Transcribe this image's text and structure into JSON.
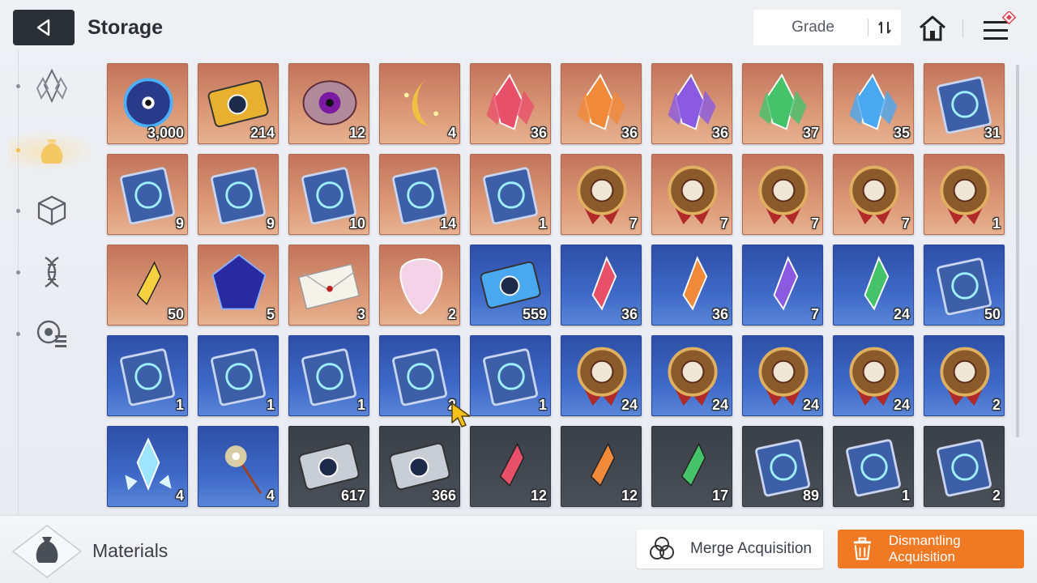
{
  "header": {
    "title": "Storage",
    "grade_label": "Grade",
    "icons": [
      "back-arrow-icon",
      "sort-icon",
      "home-icon",
      "menu-icon"
    ]
  },
  "sidebar": {
    "items": [
      {
        "icon": "crystal-icon",
        "active": false
      },
      {
        "icon": "pouch-icon",
        "active": true
      },
      {
        "icon": "cube-icon",
        "active": false
      },
      {
        "icon": "dna-icon",
        "active": false
      },
      {
        "icon": "module-list-icon",
        "active": false
      }
    ]
  },
  "items": [
    {
      "icon": "blue-creature-icon",
      "qty": "3,000",
      "bg": "orange"
    },
    {
      "icon": "gold-ticket-icon",
      "qty": "214",
      "bg": "orange"
    },
    {
      "icon": "purple-eye-core-icon",
      "qty": "12",
      "bg": "orange"
    },
    {
      "icon": "gold-moon-icon",
      "qty": "4",
      "bg": "orange"
    },
    {
      "icon": "red-crystal-cluster-icon",
      "qty": "36",
      "bg": "orange"
    },
    {
      "icon": "orange-crystal-cluster-icon",
      "qty": "36",
      "bg": "orange"
    },
    {
      "icon": "purple-crystal-cluster-icon",
      "qty": "36",
      "bg": "orange"
    },
    {
      "icon": "green-crystal-cluster-icon",
      "qty": "37",
      "bg": "orange"
    },
    {
      "icon": "blue-crystal-cluster-icon",
      "qty": "35",
      "bg": "orange"
    },
    {
      "icon": "sword-book-icon",
      "qty": "31",
      "bg": "orange"
    },
    {
      "icon": "shield-book-icon",
      "qty": "9",
      "bg": "orange"
    },
    {
      "icon": "eye-book-icon",
      "qty": "9",
      "bg": "orange"
    },
    {
      "icon": "wing-book-icon",
      "qty": "10",
      "bg": "orange"
    },
    {
      "icon": "bolt-book-icon",
      "qty": "14",
      "bg": "orange"
    },
    {
      "icon": "rune-book-icon",
      "qty": "1",
      "bg": "orange"
    },
    {
      "icon": "shield-medal-icon",
      "qty": "7",
      "bg": "orange"
    },
    {
      "icon": "eye-medal-icon",
      "qty": "7",
      "bg": "orange"
    },
    {
      "icon": "wing-medal-icon",
      "qty": "7",
      "bg": "orange"
    },
    {
      "icon": "bolt-medal-icon",
      "qty": "7",
      "bg": "orange"
    },
    {
      "icon": "rune-medal-icon",
      "qty": "1",
      "bg": "orange"
    },
    {
      "icon": "yellow-shards-icon",
      "qty": "50",
      "bg": "orange"
    },
    {
      "icon": "dark-cube-icon",
      "qty": "5",
      "bg": "orange"
    },
    {
      "icon": "envelope-icon",
      "qty": "3",
      "bg": "orange"
    },
    {
      "icon": "opal-pick-icon",
      "qty": "2",
      "bg": "orange"
    },
    {
      "icon": "blue-ticket-icon",
      "qty": "559",
      "bg": "blue"
    },
    {
      "icon": "red-crystal-icon",
      "qty": "36",
      "bg": "blue"
    },
    {
      "icon": "orange-crystal-icon",
      "qty": "36",
      "bg": "blue"
    },
    {
      "icon": "purple-crystal-icon",
      "qty": "7",
      "bg": "blue"
    },
    {
      "icon": "green-crystal-icon",
      "qty": "24",
      "bg": "blue"
    },
    {
      "icon": "sword-book-icon",
      "qty": "50",
      "bg": "blue"
    },
    {
      "icon": "shield-book-icon",
      "qty": "1",
      "bg": "blue"
    },
    {
      "icon": "eye-book-icon",
      "qty": "1",
      "bg": "blue"
    },
    {
      "icon": "wing-book-icon",
      "qty": "1",
      "bg": "blue"
    },
    {
      "icon": "bolt-book-icon",
      "qty": "2",
      "bg": "blue"
    },
    {
      "icon": "rune-book-icon",
      "qty": "1",
      "bg": "blue"
    },
    {
      "icon": "shield-medal-icon",
      "qty": "24",
      "bg": "blue"
    },
    {
      "icon": "eye-medal-icon",
      "qty": "24",
      "bg": "blue"
    },
    {
      "icon": "wing-medal-icon",
      "qty": "24",
      "bg": "blue"
    },
    {
      "icon": "bolt-medal-icon",
      "qty": "24",
      "bg": "blue"
    },
    {
      "icon": "rune-medal-icon",
      "qty": "2",
      "bg": "blue"
    },
    {
      "icon": "ice-crystal-icon",
      "qty": "4",
      "bg": "blue"
    },
    {
      "icon": "sparkler-icon",
      "qty": "4",
      "bg": "blue"
    },
    {
      "icon": "silver-portrait-ticket-icon",
      "qty": "617",
      "bg": "dark"
    },
    {
      "icon": "silver-ticket-icon",
      "qty": "366",
      "bg": "dark"
    },
    {
      "icon": "red-shard-icon",
      "qty": "12",
      "bg": "dark"
    },
    {
      "icon": "orange-shard-icon",
      "qty": "12",
      "bg": "dark"
    },
    {
      "icon": "green-shard-icon",
      "qty": "17",
      "bg": "dark"
    },
    {
      "icon": "sword-book-icon",
      "qty": "89",
      "bg": "dark"
    },
    {
      "icon": "shield-book-icon",
      "qty": "1",
      "bg": "dark"
    },
    {
      "icon": "eye-book-icon",
      "qty": "2",
      "bg": "dark"
    }
  ],
  "footer": {
    "category_icon": "pouch-icon",
    "category_label": "Materials",
    "merge_label": "Merge Acquisition",
    "dismantle_label": "Dismantling Acquisition",
    "dismantle_color": "#f07a24"
  }
}
